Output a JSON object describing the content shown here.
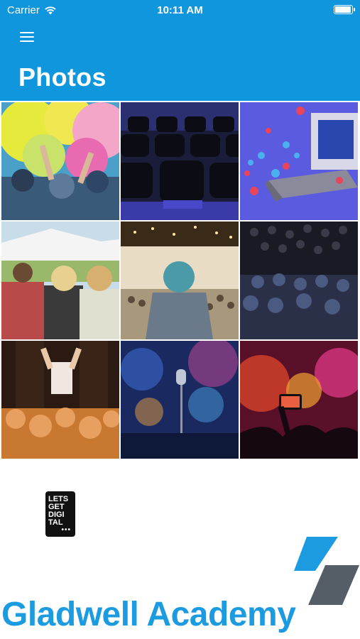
{
  "status_bar": {
    "carrier": "Carrier",
    "time": "10:11 AM",
    "battery_level": 0.95
  },
  "header": {
    "menu_icon": "hamburger-menu-icon",
    "title": "Photos",
    "background_color": "#0f96dc"
  },
  "photos": [
    {
      "subject": "color-powder-festival"
    },
    {
      "subject": "empty-auditorium-seats"
    },
    {
      "subject": "live-stream-stage-with-reactions"
    },
    {
      "subject": "outdoor-festival-crowd"
    },
    {
      "subject": "speaker-at-conference"
    },
    {
      "subject": "seated-audience-dark"
    },
    {
      "subject": "crowd-surfing-concert"
    },
    {
      "subject": "stage-microphone-blue-lights"
    },
    {
      "subject": "phone-recording-concert"
    }
  ],
  "footer": {
    "badge_lines": [
      "LETS",
      "GET",
      "DIGI",
      "TAL"
    ],
    "academy_name": "Gladwell Academy",
    "brand_color": "#1d9be0"
  }
}
